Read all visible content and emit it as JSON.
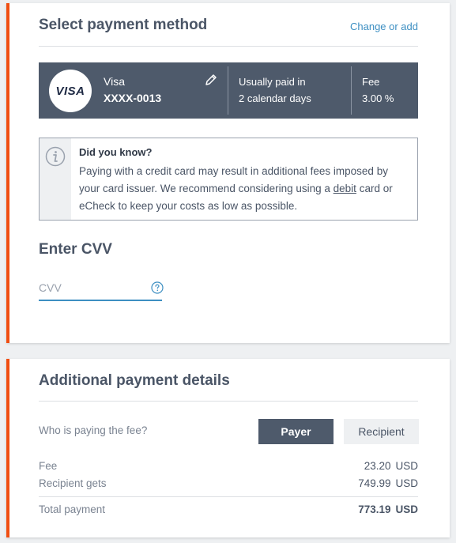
{
  "payment_method": {
    "title": "Select payment method",
    "change_link": "Change or add",
    "card": {
      "brand_logo": "VISA",
      "name": "Visa",
      "number": "XXXX-0013",
      "paid_line1": "Usually paid in",
      "paid_line2": "2 calendar days",
      "fee_label": "Fee",
      "fee_value": "3.00 %"
    },
    "info": {
      "title": "Did you know?",
      "text_before": "Paying with a credit card may result in additional fees imposed by your card issuer. We recommend considering using a ",
      "link": "debit",
      "text_after": " card or eCheck to keep your costs as low as possible."
    },
    "cvv": {
      "title": "Enter CVV",
      "placeholder": "CVV",
      "value": ""
    }
  },
  "details": {
    "title": "Additional payment details",
    "who_pays_label": "Who is paying the fee?",
    "options": [
      "Payer",
      "Recipient"
    ],
    "selected": "Payer",
    "fee_label": "Fee",
    "fee_amount": "23.20",
    "recipient_label": "Recipient gets",
    "recipient_amount": "749.99",
    "total_label": "Total payment",
    "total_amount": "773.19",
    "currency": "USD"
  },
  "colors": {
    "accent": "#f04e12",
    "link": "#3d8fc2",
    "dark": "#4e5a6b"
  }
}
